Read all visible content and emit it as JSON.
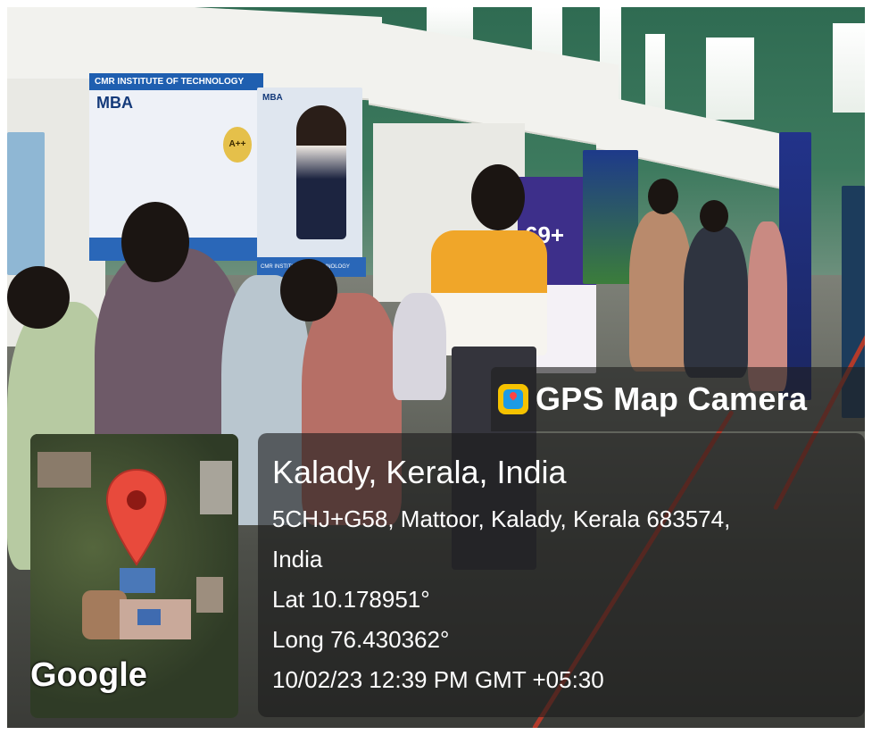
{
  "overlay": {
    "app_name": "GPS Map Camera",
    "app_icon": "gps-map-camera-icon",
    "location_title": "Kalady, Kerala, India",
    "address_line1": "5CHJ+G58, Mattoor, Kalady, Kerala 683574,",
    "address_line2": "India",
    "latitude": "Lat 10.178951°",
    "longitude": "Long 76.430362°",
    "datetime": "10/02/23 12:39 PM GMT +05:30",
    "map_logo": "Google",
    "map_marker_color": "#e84a3c"
  },
  "photo": {
    "poster_1": {
      "heading": "CMR INSTITUTE OF TECHNOLOGY",
      "title": "MBA"
    },
    "poster_2": {
      "title": "MBA",
      "footer": "CMR INSTITUTE OF TECHNOLOGY"
    },
    "badge": "A++",
    "banner_number": "69+"
  }
}
